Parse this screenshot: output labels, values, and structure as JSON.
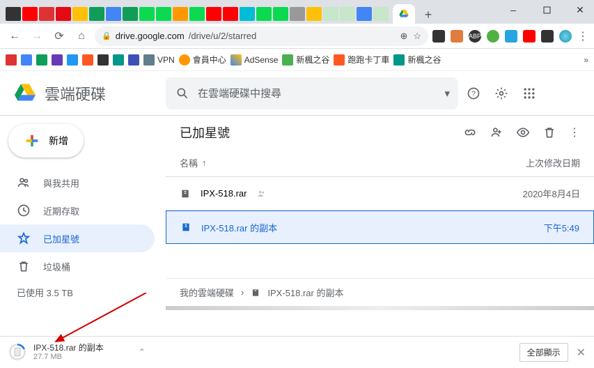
{
  "window": {
    "minimize": "–",
    "close": "✕"
  },
  "browser": {
    "protocol_icon": "🔒",
    "host": "drive.google.com",
    "path": "/drive/u/2/starred",
    "star_icon": "☆",
    "zoom_icon": "⊕"
  },
  "bookmarks": [
    {
      "label": "VPN"
    },
    {
      "label": "會員中心"
    },
    {
      "label": "AdSense"
    },
    {
      "label": "新楓之谷"
    },
    {
      "label": "跑跑卡丁車"
    },
    {
      "label": "新楓之谷"
    }
  ],
  "drive": {
    "app_name": "雲端硬碟",
    "search_placeholder": "在雲端硬碟中搜尋",
    "new_label": "新增",
    "sidebar": {
      "shared": "與我共用",
      "recent": "近期存取",
      "starred": "已加星號",
      "trash": "垃圾桶",
      "storage": "已使用 3.5 TB"
    },
    "main_title": "已加星號",
    "columns": {
      "name": "名稱",
      "modified": "上次修改日期"
    },
    "rows": [
      {
        "name": "IPX-518.rar",
        "modified": "2020年8月4日"
      },
      {
        "name": "IPX-518.rar 的副本",
        "modified": "下午5:49"
      }
    ],
    "breadcrumb": {
      "root": "我的雲端硬碟",
      "file": "IPX-518.rar 的副本"
    }
  },
  "download": {
    "filename": "IPX-518.rar 的副本",
    "size": "27.7 MB",
    "show_all": "全部顯示"
  }
}
